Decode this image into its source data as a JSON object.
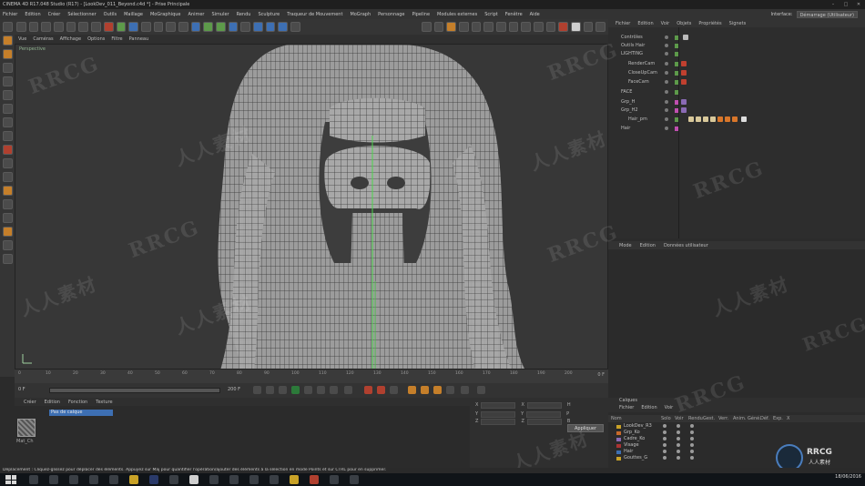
{
  "window": {
    "title": "CINEMA 4D R17.048 Studio (R17) - [LookDev_011_Beyond.c4d *] - Prise Principale"
  },
  "menu": [
    "Fichier",
    "Edition",
    "Créer",
    "Sélectionner",
    "Outils",
    "Maillage",
    "MoGraphique",
    "Animer",
    "Simuler",
    "Rendu",
    "Sculpture",
    "Traqueur de Mouvement",
    "MoGraph",
    "Personnage",
    "Pipeline",
    "Modules externes",
    "Script",
    "Fenêtre",
    "Aide"
  ],
  "interface": {
    "label": "Interface:",
    "value": "Démarrage (Utilisateur)"
  },
  "viewport_menu": [
    "Vue",
    "Caméras",
    "Affichage",
    "Options",
    "Filtre",
    "Panneau"
  ],
  "viewport": {
    "label": "Perspective"
  },
  "timeline": {
    "ticks": [
      "0",
      "10",
      "20",
      "30",
      "40",
      "50",
      "60",
      "70",
      "80",
      "90",
      "100",
      "110",
      "120",
      "130",
      "140",
      "150",
      "160",
      "170",
      "180",
      "190",
      "200"
    ],
    "end_label": "0 F",
    "start_frame": "0 F",
    "end_frame": "200 F"
  },
  "materials": {
    "menu": [
      "Créer",
      "Edition",
      "Fonction",
      "Texture"
    ],
    "filter": "Pas de calque",
    "material_name": "Mat_Ch"
  },
  "coordinates": {
    "rows": [
      {
        "a": "X",
        "b": "X",
        "c": "H"
      },
      {
        "a": "Y",
        "b": "Y",
        "c": "P"
      },
      {
        "a": "Z",
        "b": "Z",
        "c": "B"
      }
    ],
    "apply": "Appliquer"
  },
  "objects": {
    "menu": [
      "Fichier",
      "Edition",
      "Voir",
      "Objets",
      "Propriétés",
      "Signets"
    ],
    "rows": [
      {
        "name": "Contrôles",
        "indent": 0
      },
      {
        "name": "Outils Hair",
        "indent": 0
      },
      {
        "name": "LIGHTING",
        "indent": 0
      },
      {
        "name": "RenderCam",
        "indent": 1
      },
      {
        "name": "CloseUpCam",
        "indent": 1
      },
      {
        "name": "FaceCam",
        "indent": 1
      },
      {
        "name": "FACE",
        "indent": 0
      },
      {
        "name": "Grp_H",
        "indent": 0
      },
      {
        "name": "Grp_H2",
        "indent": 0
      },
      {
        "name": "Hair_pm",
        "indent": 1
      },
      {
        "name": "Hair",
        "indent": 0
      }
    ]
  },
  "attributes": {
    "menu": [
      "Mode",
      "Edition",
      "Données utilisateur"
    ]
  },
  "layers": {
    "title": "Calques",
    "menu": [
      "Fichier",
      "Edition",
      "Voir"
    ],
    "columns": [
      "Nom",
      "Solo",
      "Voir",
      "Rendu",
      "Gest.",
      "Verr.",
      "Anim.",
      "Géné.",
      "Déf.",
      "Exp.",
      "X"
    ],
    "rows": [
      {
        "name": "LookDev_R3",
        "color": "#c9a227"
      },
      {
        "name": "Grp_Ko",
        "color": "#c76a2a"
      },
      {
        "name": "Cadre_Ko",
        "color": "#8a6ab5"
      },
      {
        "name": "Visage",
        "color": "#a33"
      },
      {
        "name": "Hair",
        "color": "#3d6fb3"
      },
      {
        "name": "Gouttes_G",
        "color": "#c9a227"
      }
    ]
  },
  "status": "Déplacement : Cliquez-glissez pour déplacer des éléments. Appuyez sur Maj pour quantifier l'opération/ajouter des éléments à la sélection en mode Points et sur CTRL pour en supprimer.",
  "clock": {
    "time": "",
    "date": "18/06/2016"
  },
  "watermarks": [
    "RRCG",
    "人人素材",
    "RRCG",
    "人人素材",
    "RRCG",
    "人人素材",
    "RRCG",
    "人人素材",
    "RRCG",
    "RRCG",
    "人人素材",
    "RRCG",
    "人人素材"
  ],
  "logo": {
    "text": "RRCG",
    "sub": "人人素材"
  }
}
